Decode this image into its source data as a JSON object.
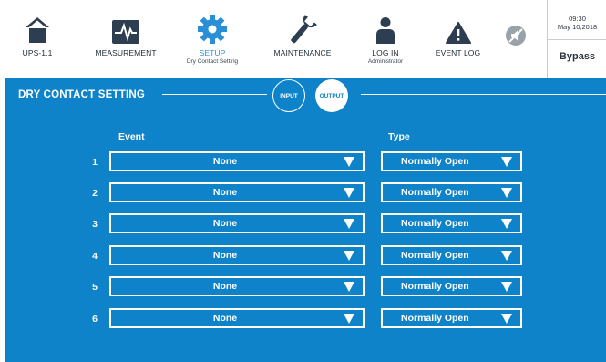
{
  "nav": {
    "items": [
      {
        "label": "UPS-1.1",
        "sub": "",
        "icon": "home-icon"
      },
      {
        "label": "MEASUREMENT",
        "sub": "",
        "icon": "waveform-icon"
      },
      {
        "label": "SETUP",
        "sub": "Dry Contact Setting",
        "icon": "gear-icon"
      },
      {
        "label": "MAINTENANCE",
        "sub": "",
        "icon": "wrench-icon"
      },
      {
        "label": "LOG IN",
        "sub": "Administrator",
        "icon": "user-icon"
      },
      {
        "label": "EVENT LOG",
        "sub": "",
        "icon": "warning-icon"
      }
    ],
    "mute_icon": "mute-icon",
    "active_index": 2
  },
  "status": {
    "time": "09:30",
    "date": "May 10,2018",
    "mode": "Bypass"
  },
  "page": {
    "title": "DRY CONTACT SETTING",
    "toggle_input": "INPUT",
    "toggle_output": "OUTPUT",
    "selected_toggle": "OUTPUT"
  },
  "table": {
    "col_event": "Event",
    "col_type": "Type",
    "rows": [
      {
        "num": "1",
        "event": "None",
        "type": "Normally Open"
      },
      {
        "num": "2",
        "event": "None",
        "type": "Normally Open"
      },
      {
        "num": "3",
        "event": "None",
        "type": "Normally Open"
      },
      {
        "num": "4",
        "event": "None",
        "type": "Normally Open"
      },
      {
        "num": "5",
        "event": "None",
        "type": "Normally Open"
      },
      {
        "num": "6",
        "event": "None",
        "type": "Normally Open"
      }
    ]
  },
  "colors": {
    "accent_blue": "#0f83c9",
    "icon_dark": "#2c3e50",
    "active_blue": "#2a8fd6",
    "mute_gray": "#9aa2a9"
  }
}
